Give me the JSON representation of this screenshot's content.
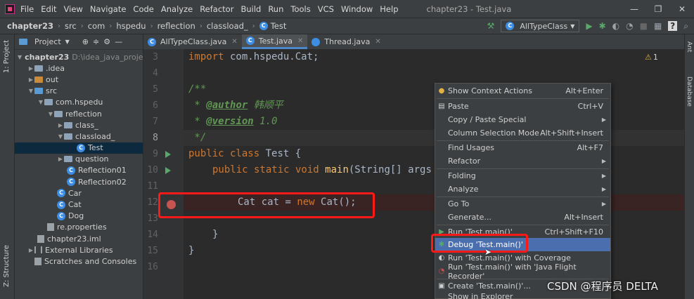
{
  "window": {
    "menus": [
      "File",
      "Edit",
      "View",
      "Navigate",
      "Code",
      "Analyze",
      "Refactor",
      "Build",
      "Run",
      "Tools",
      "VCS",
      "Window",
      "Help"
    ],
    "title": "chapter23 - Test.java",
    "controls": [
      "—",
      "❐",
      "✕"
    ]
  },
  "nav": {
    "crumbs": [
      "chapter23",
      "src",
      "com",
      "hspedu",
      "reflection",
      "classload_",
      "Test"
    ],
    "run_config": "AllTypeClass"
  },
  "tool_strip": {
    "project_tab": "1: Project",
    "structure_tab": "Z: Structure",
    "right_tab_1": "Ant",
    "right_tab_2": "Database"
  },
  "project_panel": {
    "title": "Project",
    "tree": [
      {
        "label": "chapter23",
        "path": "D:\\idea_java_proje"
      },
      {
        "label": ".idea"
      },
      {
        "label": "out"
      },
      {
        "label": "src"
      },
      {
        "label": "com.hspedu"
      },
      {
        "label": "reflection"
      },
      {
        "label": "class_"
      },
      {
        "label": "classload_"
      },
      {
        "label": "Test"
      },
      {
        "label": "question"
      },
      {
        "label": "Reflection01"
      },
      {
        "label": "Reflection02"
      },
      {
        "label": "Car"
      },
      {
        "label": "Cat"
      },
      {
        "label": "Dog"
      },
      {
        "label": "re.properties"
      },
      {
        "label": "chapter23.iml"
      },
      {
        "label": "External Libraries"
      },
      {
        "label": "Scratches and Consoles"
      }
    ]
  },
  "tabs": [
    {
      "label": "AllTypeClass.java"
    },
    {
      "label": "Test.java"
    },
    {
      "label": "Thread.java"
    }
  ],
  "editor": {
    "line_numbers": [
      "3",
      "4",
      "5",
      "6",
      "7",
      "8",
      "9",
      "10",
      "11",
      "12",
      "13",
      "14",
      "15",
      "16"
    ],
    "l3_kw": "import",
    "l3_rest": " com.hspedu.Cat;",
    "l5": "/**",
    "l6_star": " * ",
    "l6_tag": "@author",
    "l6_text": " 韩顺平",
    "l7_star": " * ",
    "l7_tag": "@version",
    "l7_text": " 1.0",
    "l8": " */",
    "l9_kw": "public class",
    "l9_rest": " Test {",
    "l10_kw": "public static void",
    "l10_fn": "main",
    "l10_rest": "(String[] args",
    "l12_type": "Cat",
    "l12_var": " cat",
    "l12_eq": " = ",
    "l12_new": "new",
    "l12_rest": " Cat();",
    "l14": "}",
    "l15": "}",
    "warnings": "1"
  },
  "context_menu": {
    "items": [
      {
        "label": "Show Context Actions",
        "shortcut": "Alt+Enter"
      },
      {
        "label": "Paste",
        "shortcut": "Ctrl+V"
      },
      {
        "label": "Copy / Paste Special",
        "shortcut": ""
      },
      {
        "label": "Column Selection Mode",
        "shortcut": "Alt+Shift+Insert"
      },
      {
        "label": "Find Usages",
        "shortcut": "Alt+F7"
      },
      {
        "label": "Refactor",
        "shortcut": ""
      },
      {
        "label": "Folding",
        "shortcut": ""
      },
      {
        "label": "Analyze",
        "shortcut": ""
      },
      {
        "label": "Go To",
        "shortcut": ""
      },
      {
        "label": "Generate...",
        "shortcut": "Alt+Insert"
      },
      {
        "label": "Run 'Test.main()'",
        "shortcut": "Ctrl+Shift+F10"
      },
      {
        "label": "Debug 'Test.main()'",
        "shortcut": ""
      },
      {
        "label": "Run 'Test.main()' with Coverage",
        "shortcut": ""
      },
      {
        "label": "Run 'Test.main()' with 'Java Flight Recorder'",
        "shortcut": ""
      },
      {
        "label": "Create 'Test.main()'...",
        "shortcut": ""
      },
      {
        "label": "Show in Explorer",
        "shortcut": ""
      }
    ]
  },
  "watermark": "CSDN @程序员 DELTA",
  "colors": {
    "breakpoint": "#c75450",
    "highlight_box": "#ff1a1a",
    "menu_selection": "#4b6eaf",
    "keyword": "#cc7832",
    "comment": "#629755"
  }
}
